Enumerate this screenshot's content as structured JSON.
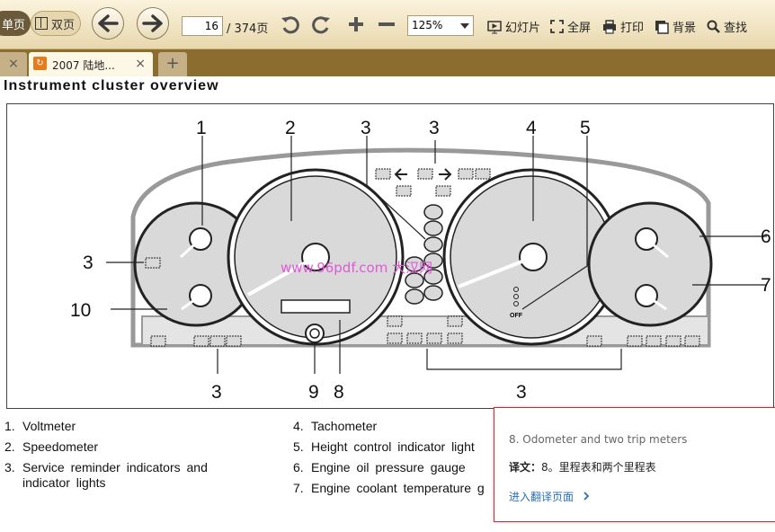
{
  "toolbar": {
    "single_page_label": "单页",
    "double_page_label": "双页",
    "current_page": "16",
    "total_pages": "/ 374页",
    "zoom_value": "125%",
    "slideshow_label": "幻灯片",
    "fullscreen_label": "全屏",
    "print_label": "打印",
    "background_label": "背景",
    "search_label": "查找",
    "icons": [
      "back-arrow-icon",
      "forward-arrow-icon",
      "rotate-left-icon",
      "rotate-right-icon",
      "zoom-in-icon",
      "zoom-out-icon",
      "slideshow-icon",
      "fullscreen-icon",
      "print-icon",
      "background-icon",
      "search-icon"
    ]
  },
  "tabs": {
    "previous_close": "×",
    "active_title": "2007 陆地...",
    "active_close": "×",
    "new_tab": "+"
  },
  "document": {
    "heading": "Instrument  cluster  overview",
    "figure": {
      "callouts": [
        "1",
        "2",
        "3",
        "3",
        "4",
        "5",
        "6",
        "7",
        "3",
        "10",
        "3",
        "9",
        "8",
        "3"
      ],
      "off_label": "OFF",
      "watermark": "www.96pdf.com 大汉网"
    },
    "legend_left": [
      {
        "num": "1.",
        "text": "Voltmeter"
      },
      {
        "num": "2.",
        "text": "Speedometer"
      },
      {
        "num": "3.",
        "text": "Service reminder indicators and"
      },
      {
        "num": "",
        "text": "indicator lights"
      }
    ],
    "legend_right": [
      {
        "num": "4.",
        "text": "Tachometer"
      },
      {
        "num": "5.",
        "text": "Height control indicator light"
      },
      {
        "num": "6.",
        "text": "Engine oil pressure gauge"
      },
      {
        "num": "7.",
        "text": "Engine coolant temperature g"
      }
    ]
  },
  "translation_popup": {
    "source": "8. Odometer and two trip meters",
    "label": "译文：",
    "translation": "8。里程表和两个里程表",
    "link": "进入翻译页面",
    "border_color": "#d22233"
  },
  "colors": {
    "toolbar_bg": "#f1e5c4",
    "tabbar_bg": "#8b6d2f",
    "link": "#2a6fb8",
    "gauge_fill": "#d9d9d9"
  }
}
